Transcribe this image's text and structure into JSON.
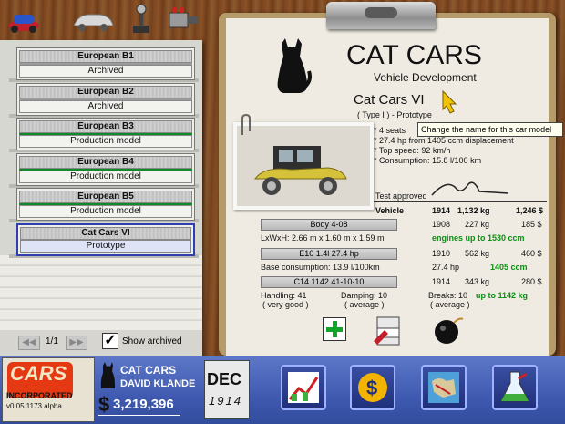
{
  "toolbar": {
    "icons": [
      "car-icon",
      "car-body-icon",
      "gear-shift-icon",
      "engine-icon"
    ]
  },
  "folders": [
    {
      "name": "European B1",
      "status": "Archived",
      "bar": "gray"
    },
    {
      "name": "European B2",
      "status": "Archived",
      "bar": "gray"
    },
    {
      "name": "European B3",
      "status": "Production model",
      "bar": "green"
    },
    {
      "name": "European B4",
      "status": "Production model",
      "bar": "green"
    },
    {
      "name": "European B5",
      "status": "Production model",
      "bar": "green"
    },
    {
      "name": "Cat Cars VI",
      "status": "Prototype",
      "bar": "none",
      "selected": true
    }
  ],
  "pager": {
    "page": "1/1",
    "show_archived_label": "Show archived",
    "show_archived_checked": true
  },
  "document": {
    "company": "CAT CARS",
    "subtitle": "Vehicle Development",
    "model_name": "Cat Cars VI",
    "type_line": "( Type I ) - Prototype",
    "tooltip": "Change the name for this car model",
    "specs": [
      "* 4 seats",
      "* 27.4 hp from 1405 ccm displacement",
      "* Top speed: 92 km/h",
      "* Consumption: 15.8 l/100 km"
    ],
    "test_approved": "Test approved",
    "vehicle_label": "Vehicle",
    "vehicle_year": "1914",
    "vehicle_weight": "1,132 kg",
    "vehicle_price": "1,246 $",
    "body": {
      "name": "Body 4-08",
      "year": "1908",
      "weight": "227 kg",
      "price": "185 $",
      "dims": "LxWxH: 2.66 m x 1.60 m x 1.59 m",
      "note": "engines up to 1530 ccm"
    },
    "engine": {
      "name": "E10 1.4l 27.4 hp",
      "year": "1910",
      "weight": "562 kg",
      "price": "460 $",
      "consumption": "Base consumption: 13.9 l/100km",
      "hp": "27.4 hp",
      "ccm": "1405 ccm"
    },
    "chassis": {
      "name": "C14 1142 41-10-10",
      "year": "1914",
      "weight": "343 kg",
      "price": "280 $",
      "handling": "Handling: 41",
      "handling_rating": "( very good )",
      "damping": "Damping: 10",
      "damping_rating": "( average )",
      "brakes": "Breaks: 10",
      "brakes_rating": "( average )",
      "note": "up to 1142 kg"
    }
  },
  "bottom": {
    "logo_title": "CARS",
    "logo_sub": "INCORPORATED",
    "version": "v0.05.1173 alpha",
    "company": "CAT CARS",
    "owner": "DAVID KLANDE",
    "money_symbol": "$",
    "money": "3,219,396",
    "month": "DEC",
    "year": "1914"
  },
  "colors": {
    "accent_green": "#0a8f12",
    "selected_border": "#2f3fb0",
    "bottom_bar": "#3f5ab0"
  }
}
